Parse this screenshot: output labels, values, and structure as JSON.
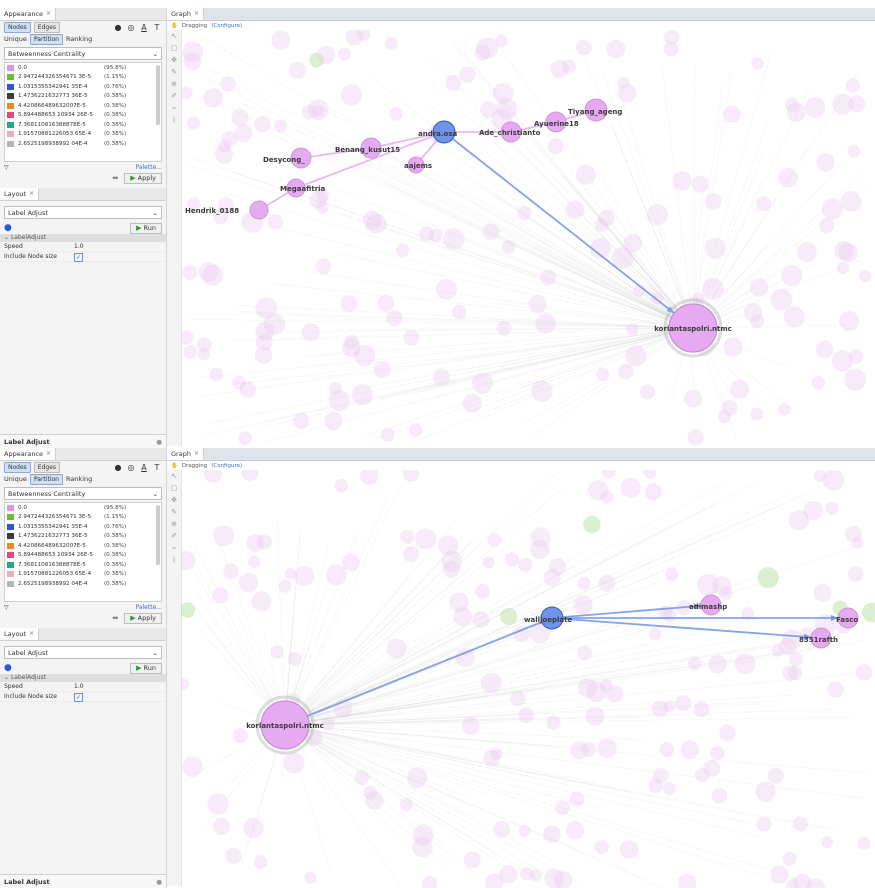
{
  "appearance": {
    "tab_title": "Appearance",
    "mode_tabs": [
      "Nodes",
      "Edges"
    ],
    "sub_tabs": [
      "Unique",
      "Partition",
      "Ranking"
    ],
    "attribute": "Betweenness Centrality",
    "partitions": [
      {
        "value": "0.0",
        "pct": "(95.8%)",
        "color": "#d796ea"
      },
      {
        "value": "2.947244326354671 3E-5",
        "pct": "(1.15%)",
        "color": "#6fba3c"
      },
      {
        "value": "1.0315355342941 35E-4",
        "pct": "(0.76%)",
        "color": "#2c57d6"
      },
      {
        "value": "1.4736221632773 36E-5",
        "pct": "(0.38%)",
        "color": "#3b3b3b"
      },
      {
        "value": "4.420866489632007E-5",
        "pct": "(0.38%)",
        "color": "#f08a22"
      },
      {
        "value": "5.894488653 10934 26E-5",
        "pct": "(0.38%)",
        "color": "#e14a7c"
      },
      {
        "value": "7.368110816388878E-5",
        "pct": "(0.38%)",
        "color": "#1fa88a"
      },
      {
        "value": "1.91570881226053 65E-4",
        "pct": "(0.38%)",
        "color": "#e8b0b8"
      },
      {
        "value": "2.6525198938992 04E-4",
        "pct": "(0.38%)",
        "color": "#b4b4b4"
      }
    ],
    "palette_link": "Palette...",
    "apply_label": "Apply"
  },
  "layout": {
    "tab_title": "Layout",
    "algorithm": "Label Adjust",
    "run_label": "Run",
    "section_title": "LabelAdjust",
    "speed_label": "Speed",
    "speed_value": "1.0",
    "node_size_label": "Include Node size",
    "bottom_label": "Label Adjust"
  },
  "graph": {
    "tab_title": "Graph",
    "dragging": "Dragging",
    "configure": "(Configure)"
  },
  "top_view": {
    "nodes": [
      {
        "name": "Hendrik_0188"
      },
      {
        "name": "Megaafitria"
      },
      {
        "name": "Desycong_"
      },
      {
        "name": "Benang_kusut15"
      },
      {
        "name": "aajems"
      },
      {
        "name": "andra.osa"
      },
      {
        "name": "Ade_christianto"
      },
      {
        "name": "Ayuerine18"
      },
      {
        "name": "Tiyang_ageng"
      },
      {
        "name": "koriantaspolri.ntmc"
      }
    ]
  },
  "bottom_view": {
    "nodes": [
      {
        "name": "korlantaspolri.ntmc"
      },
      {
        "name": "walljoeplate"
      },
      {
        "name": "adimashp"
      },
      {
        "name": "Fasco"
      },
      {
        "name": "8351rafth"
      }
    ]
  },
  "colors": {
    "accent": "#3b6fc9",
    "node_pink": "#e7a9f2",
    "edge_blue": "#6f93e6"
  }
}
